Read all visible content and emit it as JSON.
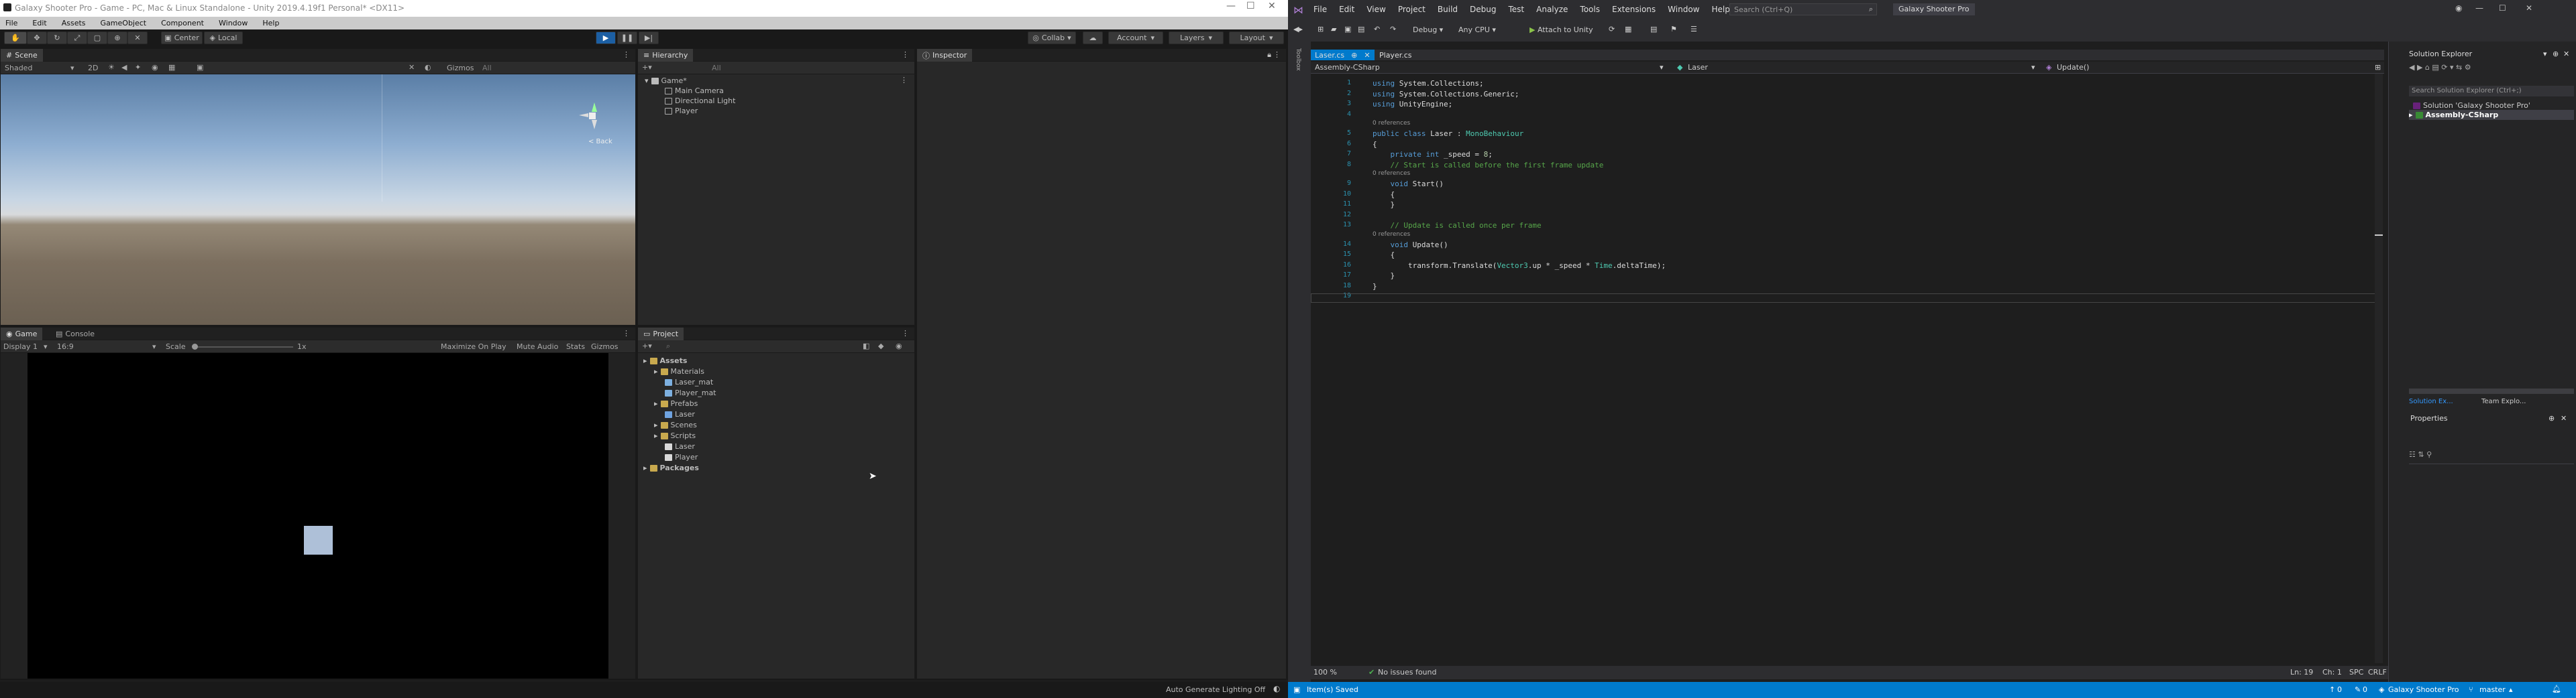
{
  "unity": {
    "title": "Galaxy Shooter Pro - Game - PC, Mac & Linux Standalone - Unity 2019.4.19f1 Personal* <DX11>",
    "menu": [
      "File",
      "Edit",
      "Assets",
      "GameObject",
      "Component",
      "Window",
      "Help"
    ],
    "toolbar": {
      "center": "Center",
      "local": "Local",
      "collab": "Collab",
      "account": "Account",
      "layers": "Layers",
      "layout": "Layout"
    },
    "scene": {
      "tab": "Scene",
      "shading": "Shaded",
      "mode_2d": "2D",
      "gizmos": "Gizmos",
      "search": "All",
      "back": "< Back"
    },
    "game": {
      "tab": "Game",
      "console_tab": "Console",
      "display": "Display 1",
      "aspect": "16:9",
      "scale_label": "Scale",
      "scale_value": "1x",
      "maximize": "Maximize On Play",
      "mute": "Mute Audio",
      "stats": "Stats",
      "gizmos": "Gizmos"
    },
    "hierarchy": {
      "tab": "Hierarchy",
      "search": "All",
      "scene": "Game*",
      "items": [
        "Main Camera",
        "Directional Light",
        "Player"
      ]
    },
    "inspector": {
      "tab": "Inspector"
    },
    "project": {
      "tab": "Project",
      "tree": [
        {
          "label": "Assets",
          "level": 0,
          "kind": "folder"
        },
        {
          "label": "Materials",
          "level": 1,
          "kind": "folder"
        },
        {
          "label": "Laser_mat",
          "level": 2,
          "kind": "material"
        },
        {
          "label": "Player_mat",
          "level": 2,
          "kind": "material"
        },
        {
          "label": "Prefabs",
          "level": 1,
          "kind": "folder"
        },
        {
          "label": "Laser",
          "level": 2,
          "kind": "prefab"
        },
        {
          "label": "Scenes",
          "level": 1,
          "kind": "folder"
        },
        {
          "label": "Scripts",
          "level": 1,
          "kind": "folder"
        },
        {
          "label": "Laser",
          "level": 2,
          "kind": "script"
        },
        {
          "label": "Player",
          "level": 2,
          "kind": "script"
        },
        {
          "label": "Packages",
          "level": 0,
          "kind": "folder"
        }
      ]
    },
    "status": "Auto Generate Lighting Off"
  },
  "vs": {
    "menu": [
      "File",
      "Edit",
      "View",
      "Project",
      "Build",
      "Debug",
      "Test",
      "Analyze",
      "Tools",
      "Extensions",
      "Window",
      "Help"
    ],
    "search_placeholder": "Search (Ctrl+Q)",
    "solution_name": "Galaxy Shooter Pro",
    "toolbar": {
      "config": "Debug",
      "platform": "Any CPU",
      "attach": "Attach to Unity"
    },
    "tabs": [
      {
        "label": "Laser.cs",
        "active": true
      },
      {
        "label": "Player.cs",
        "active": false
      }
    ],
    "nav": {
      "project": "Assembly-CSharp",
      "class": "Laser",
      "member": "Update()"
    },
    "code_lines": [
      {
        "n": "1",
        "text": "using System.Collections;"
      },
      {
        "n": "2",
        "text": "using System.Collections.Generic;"
      },
      {
        "n": "3",
        "text": "using UnityEngine;"
      },
      {
        "n": "4",
        "text": ""
      },
      {
        "n": "5",
        "text": "public class Laser : MonoBehaviour",
        "refs": "0 references"
      },
      {
        "n": "6",
        "text": "{"
      },
      {
        "n": "7",
        "text": "    private int _speed = 8;"
      },
      {
        "n": "8",
        "text": "    // Start is called before the first frame update"
      },
      {
        "n": "9",
        "text": "    void Start()",
        "refs": "0 references"
      },
      {
        "n": "10",
        "text": "    {"
      },
      {
        "n": "11",
        "text": "    }"
      },
      {
        "n": "12",
        "text": ""
      },
      {
        "n": "13",
        "text": "    // Update is called once per frame"
      },
      {
        "n": "14",
        "text": "    void Update()",
        "refs": "0 references"
      },
      {
        "n": "15",
        "text": "    {"
      },
      {
        "n": "16",
        "text": "        transform.Translate(Vector3.up * _speed * Time.deltaTime);"
      },
      {
        "n": "17",
        "text": "    }"
      },
      {
        "n": "18",
        "text": "}"
      },
      {
        "n": "19",
        "text": ""
      }
    ],
    "edit_status": {
      "zoom": "100 %",
      "issues": "No issues found",
      "ln": "Ln: 19",
      "ch": "Ch: 1",
      "spc": "SPC",
      "crlf": "CRLF"
    },
    "solution_explorer": {
      "title": "Solution Explorer",
      "search": "Search Solution Explorer (Ctrl+;)",
      "solution": "Solution 'Galaxy Shooter Pro'",
      "project": "Assembly-CSharp",
      "tab1": "Solution Ex...",
      "tab2": "Team Explo..."
    },
    "properties": {
      "title": "Properties"
    },
    "status": {
      "saved": "Item(s) Saved",
      "errors": "0",
      "pending": "0",
      "solution": "Galaxy Shooter Pro",
      "branch": "master"
    }
  }
}
